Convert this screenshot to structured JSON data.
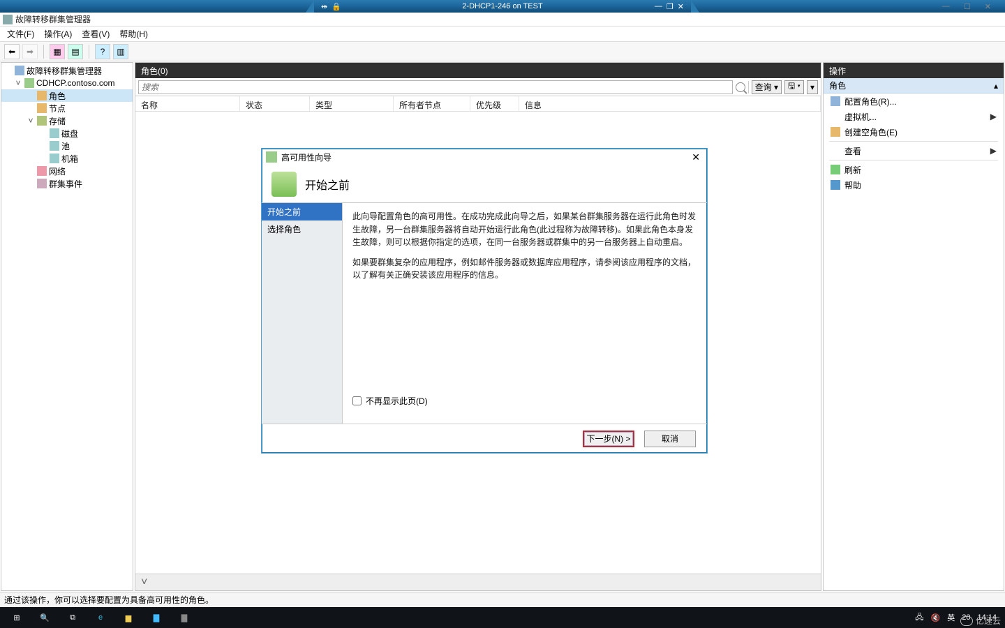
{
  "vm": {
    "title": "2-DHCP1-246 on TEST",
    "pin_icon": "pin-icon",
    "lock_icon": "lock-icon",
    "min": "—",
    "max": "❐",
    "close": "✕",
    "host_min": "—",
    "host_max": "☐",
    "host_close": "✕"
  },
  "window": {
    "title": "故障转移群集管理器",
    "menus": {
      "file": "文件(F)",
      "action": "操作(A)",
      "view": "查看(V)",
      "help": "帮助(H)"
    }
  },
  "tree": {
    "root": "故障转移群集管理器",
    "cluster": "CDHCP.contoso.com",
    "roles": "角色",
    "nodes": "节点",
    "storage": "存储",
    "disks": "磁盘",
    "pools": "池",
    "enclosures": "机箱",
    "networks": "网络",
    "events": "群集事件"
  },
  "center": {
    "header": "角色(0)",
    "search_placeholder": "搜索",
    "query": "查询",
    "columns": {
      "name": "名称",
      "status": "状态",
      "type": "类型",
      "owner": "所有者节点",
      "priority": "优先级",
      "info": "信息"
    }
  },
  "actions": {
    "header": "操作",
    "sub": "角色",
    "items": {
      "configure_role": "配置角色(R)...",
      "vm": "虚拟机...",
      "create_empty_role": "创建空角色(E)",
      "view": "查看",
      "refresh": "刷新",
      "help": "帮助"
    }
  },
  "wizard": {
    "title": "高可用性向导",
    "heading": "开始之前",
    "nav": {
      "before": "开始之前",
      "select_role": "选择角色"
    },
    "para1": "此向导配置角色的高可用性。在成功完成此向导之后，如果某台群集服务器在运行此角色时发生故障，另一台群集服务器将自动开始运行此角色(此过程称为故障转移)。如果此角色本身发生故障，则可以根据你指定的选项，在同一台服务器或群集中的另一台服务器上自动重启。",
    "para2": "如果要群集复杂的应用程序，例如邮件服务器或数据库应用程序，请参阅该应用程序的文档，以了解有关正确安装该应用程序的信息。",
    "skip_checkbox": "不再显示此页(D)",
    "next": "下一步(N) >",
    "cancel": "取消"
  },
  "status_bar": "通过该操作，你可以选择要配置为具备高可用性的角色。",
  "taskbar": {
    "ime": "英",
    "ime2": "20",
    "time": "14:14",
    "watermark": "亿速云"
  }
}
